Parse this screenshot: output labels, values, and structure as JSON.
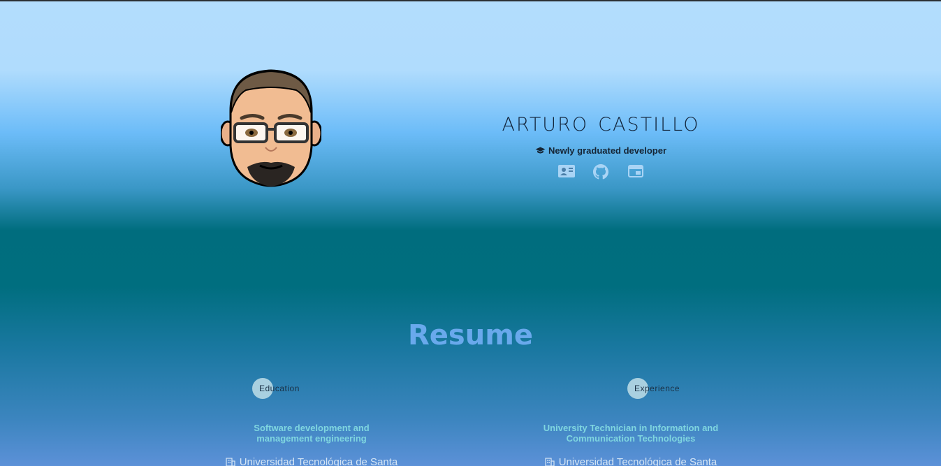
{
  "hero": {
    "name": "Arturo Castillo",
    "subtitle": "Newly graduated developer",
    "icons": [
      "contact-card-icon",
      "github-icon",
      "browser-window-icon"
    ]
  },
  "resume": {
    "title": "Resume",
    "education": {
      "label": "Education",
      "title": "Software development and management engineering",
      "org": "Universidad Tecnológica de Santa"
    },
    "experience": {
      "label": "Experience",
      "title": "University Technician in Information and Communication Technologies",
      "org": "Universidad Tecnológica de Santa"
    }
  },
  "colors": {
    "name": "#12243a",
    "resume_title": "#69a9ec",
    "entry_title": "#7fd6e0",
    "dot": "#a9d0e0"
  }
}
